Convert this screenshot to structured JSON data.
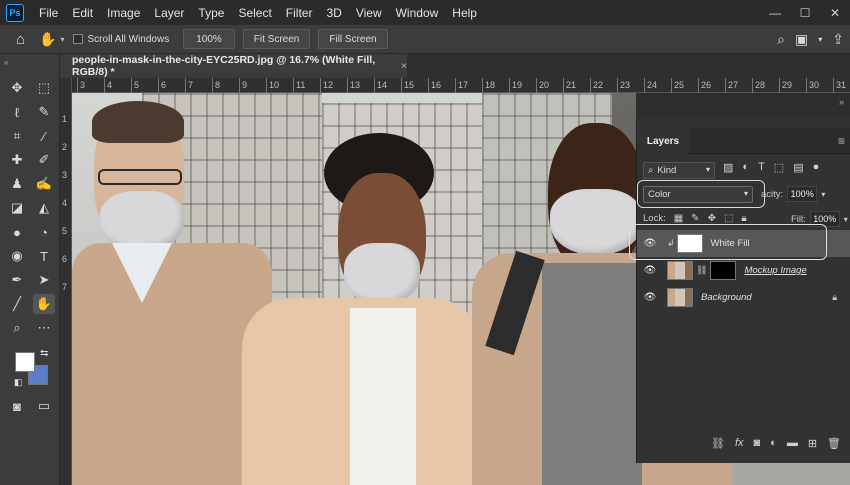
{
  "app": {
    "logo": "Ps"
  },
  "menu": [
    "File",
    "Edit",
    "Image",
    "Layer",
    "Type",
    "Select",
    "Filter",
    "3D",
    "View",
    "Window",
    "Help"
  ],
  "window_controls": {
    "minimize": "—",
    "maximize": "☐",
    "close": "✕"
  },
  "options": {
    "scroll_all_label": "Scroll All Windows",
    "zoom_value": "100%",
    "fit_screen": "Fit Screen",
    "fill_screen": "Fill Screen"
  },
  "document": {
    "tab_title": "people-in-mask-in-the-city-EYC25RD.jpg @ 16.7% (White Fill, RGB/8) *",
    "close": "×"
  },
  "ruler": {
    "top_ticks": [
      "3",
      "4",
      "5",
      "6",
      "7",
      "8",
      "9",
      "10",
      "11",
      "12",
      "13",
      "14",
      "15",
      "16",
      "17",
      "18",
      "19",
      "20",
      "21",
      "22",
      "23",
      "24",
      "25",
      "26",
      "27",
      "28",
      "29",
      "30",
      "31"
    ],
    "left_ticks": [
      "1",
      "2",
      "3",
      "4",
      "5",
      "6",
      "7"
    ]
  },
  "colors": {
    "foreground": "#ffffff",
    "background": "#5a7fc8",
    "accent": "#31a8ff"
  },
  "layers_panel": {
    "title": "Layers",
    "kind_label": "Kind",
    "blend_mode": "Color",
    "opacity_label": "acity:",
    "opacity_value": "100%",
    "lock_label": "Lock:",
    "fill_label": "Fill:",
    "fill_value": "100%",
    "layers": [
      {
        "name": "White Fill",
        "selected": true
      },
      {
        "name": "Mockup Image",
        "selected": false
      },
      {
        "name": "Background",
        "selected": false
      }
    ]
  }
}
